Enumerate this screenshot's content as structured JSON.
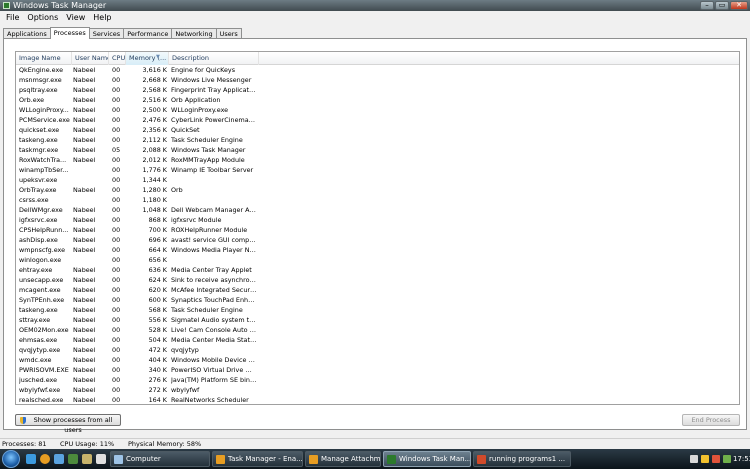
{
  "window": {
    "title": "Windows Task Manager"
  },
  "menu": [
    "File",
    "Options",
    "View",
    "Help"
  ],
  "tabs": [
    "Applications",
    "Processes",
    "Services",
    "Performance",
    "Networking",
    "Users"
  ],
  "active_tab": "Processes",
  "columns": {
    "name": "Image Name",
    "user": "User Name",
    "cpu": "CPU",
    "mem": "Memory (...",
    "desc": "Description"
  },
  "processes": [
    {
      "name": "QkEngine.exe",
      "user": "Nabeel",
      "cpu": "00",
      "mem": "3,616 K",
      "desc": "Engine for QuicKeys"
    },
    {
      "name": "msnmsgr.exe",
      "user": "Nabeel",
      "cpu": "00",
      "mem": "2,668 K",
      "desc": "Windows Live Messenger"
    },
    {
      "name": "psqltray.exe",
      "user": "Nabeel",
      "cpu": "00",
      "mem": "2,568 K",
      "desc": "Fingerprint Tray Application"
    },
    {
      "name": "Orb.exe",
      "user": "Nabeel",
      "cpu": "00",
      "mem": "2,516 K",
      "desc": "Orb Application"
    },
    {
      "name": "WLLoginProxy...",
      "user": "Nabeel",
      "cpu": "00",
      "mem": "2,500 K",
      "desc": "WLLoginProxy.exe"
    },
    {
      "name": "PCMService.exe",
      "user": "Nabeel",
      "cpu": "00",
      "mem": "2,476 K",
      "desc": "CyberLink PowerCinema R..."
    },
    {
      "name": "quickset.exe",
      "user": "Nabeel",
      "cpu": "00",
      "mem": "2,356 K",
      "desc": "QuickSet"
    },
    {
      "name": "taskeng.exe",
      "user": "Nabeel",
      "cpu": "00",
      "mem": "2,112 K",
      "desc": "Task Scheduler Engine"
    },
    {
      "name": "taskmgr.exe",
      "user": "Nabeel",
      "cpu": "05",
      "mem": "2,088 K",
      "desc": "Windows Task Manager"
    },
    {
      "name": "RoxWatchTra...",
      "user": "Nabeel",
      "cpu": "00",
      "mem": "2,012 K",
      "desc": "RoxMMTrayApp Module"
    },
    {
      "name": "winampTbSer...",
      "user": "",
      "cpu": "00",
      "mem": "1,776 K",
      "desc": "Winamp IE Toolbar Server"
    },
    {
      "name": "upeksvr.exe",
      "user": "",
      "cpu": "00",
      "mem": "1,344 K",
      "desc": ""
    },
    {
      "name": "OrbTray.exe",
      "user": "Nabeel",
      "cpu": "00",
      "mem": "1,280 K",
      "desc": "Orb"
    },
    {
      "name": "csrss.exe",
      "user": "",
      "cpu": "00",
      "mem": "1,180 K",
      "desc": ""
    },
    {
      "name": "DellWMgr.exe",
      "user": "Nabeel",
      "cpu": "00",
      "mem": "1,048 K",
      "desc": "Dell Webcam Manager App..."
    },
    {
      "name": "igfxsrvc.exe",
      "user": "Nabeel",
      "cpu": "00",
      "mem": "868 K",
      "desc": "igfxsrvc Module"
    },
    {
      "name": "CPSHelpRunn...",
      "user": "Nabeel",
      "cpu": "00",
      "mem": "700 K",
      "desc": "ROXHelpRunner Module"
    },
    {
      "name": "ashDisp.exe",
      "user": "Nabeel",
      "cpu": "00",
      "mem": "696 K",
      "desc": "avast! service GUI compo..."
    },
    {
      "name": "wmpnscfg.exe",
      "user": "Nabeel",
      "cpu": "00",
      "mem": "664 K",
      "desc": "Windows Media Player Net..."
    },
    {
      "name": "winlogon.exe",
      "user": "",
      "cpu": "00",
      "mem": "656 K",
      "desc": ""
    },
    {
      "name": "ehtray.exe",
      "user": "Nabeel",
      "cpu": "00",
      "mem": "636 K",
      "desc": "Media Center Tray Applet"
    },
    {
      "name": "unsecapp.exe",
      "user": "Nabeel",
      "cpu": "00",
      "mem": "624 K",
      "desc": "Sink to receive asynchron..."
    },
    {
      "name": "mcagent.exe",
      "user": "Nabeel",
      "cpu": "00",
      "mem": "620 K",
      "desc": "McAfee Integrated Securit..."
    },
    {
      "name": "SynTPEnh.exe",
      "user": "Nabeel",
      "cpu": "00",
      "mem": "600 K",
      "desc": "Synaptics TouchPad Enha..."
    },
    {
      "name": "taskeng.exe",
      "user": "Nabeel",
      "cpu": "00",
      "mem": "568 K",
      "desc": "Task Scheduler Engine"
    },
    {
      "name": "sttray.exe",
      "user": "Nabeel",
      "cpu": "00",
      "mem": "556 K",
      "desc": "Sigmatel Audio system tra..."
    },
    {
      "name": "OEM02Mon.exe",
      "user": "Nabeel",
      "cpu": "00",
      "mem": "528 K",
      "desc": "Live! Cam Console Auto La..."
    },
    {
      "name": "ehmsas.exe",
      "user": "Nabeel",
      "cpu": "00",
      "mem": "504 K",
      "desc": "Media Center Media Statu..."
    },
    {
      "name": "qvqjytyp.exe",
      "user": "Nabeel",
      "cpu": "00",
      "mem": "472 K",
      "desc": "qvqjytyp"
    },
    {
      "name": "wmdc.exe",
      "user": "Nabeel",
      "cpu": "00",
      "mem": "404 K",
      "desc": "Windows Mobile Device Ce..."
    },
    {
      "name": "PWRISOVM.EXE",
      "user": "Nabeel",
      "cpu": "00",
      "mem": "340 K",
      "desc": "PowerISO Virtual Drive Ma..."
    },
    {
      "name": "jusched.exe",
      "user": "Nabeel",
      "cpu": "00",
      "mem": "276 K",
      "desc": "Java(TM) Platform SE binary"
    },
    {
      "name": "wbylyfwf.exe",
      "user": "Nabeel",
      "cpu": "00",
      "mem": "272 K",
      "desc": "wbylyfwf"
    },
    {
      "name": "realsched.exe",
      "user": "Nabeel",
      "cpu": "00",
      "mem": "164 K",
      "desc": "RealNetworks Scheduler"
    }
  ],
  "buttons": {
    "show_all": "Show processes from all users",
    "end_process": "End Process"
  },
  "status": {
    "processes": "Processes: 81",
    "cpu": "CPU Usage: 11%",
    "memory": "Physical Memory: 58%"
  },
  "taskbar": {
    "items": [
      "Computer",
      "Task Manager - Ena...",
      "Manage Attachmen...",
      "Windows Task Man...",
      "running programs1 ..."
    ],
    "active_item": 3,
    "clock": "17:53"
  },
  "colors": {
    "title_bar": "#414b50",
    "taskbar": "#0c141a",
    "header_text": "#1e395b",
    "accent": "#2d6fcf"
  }
}
